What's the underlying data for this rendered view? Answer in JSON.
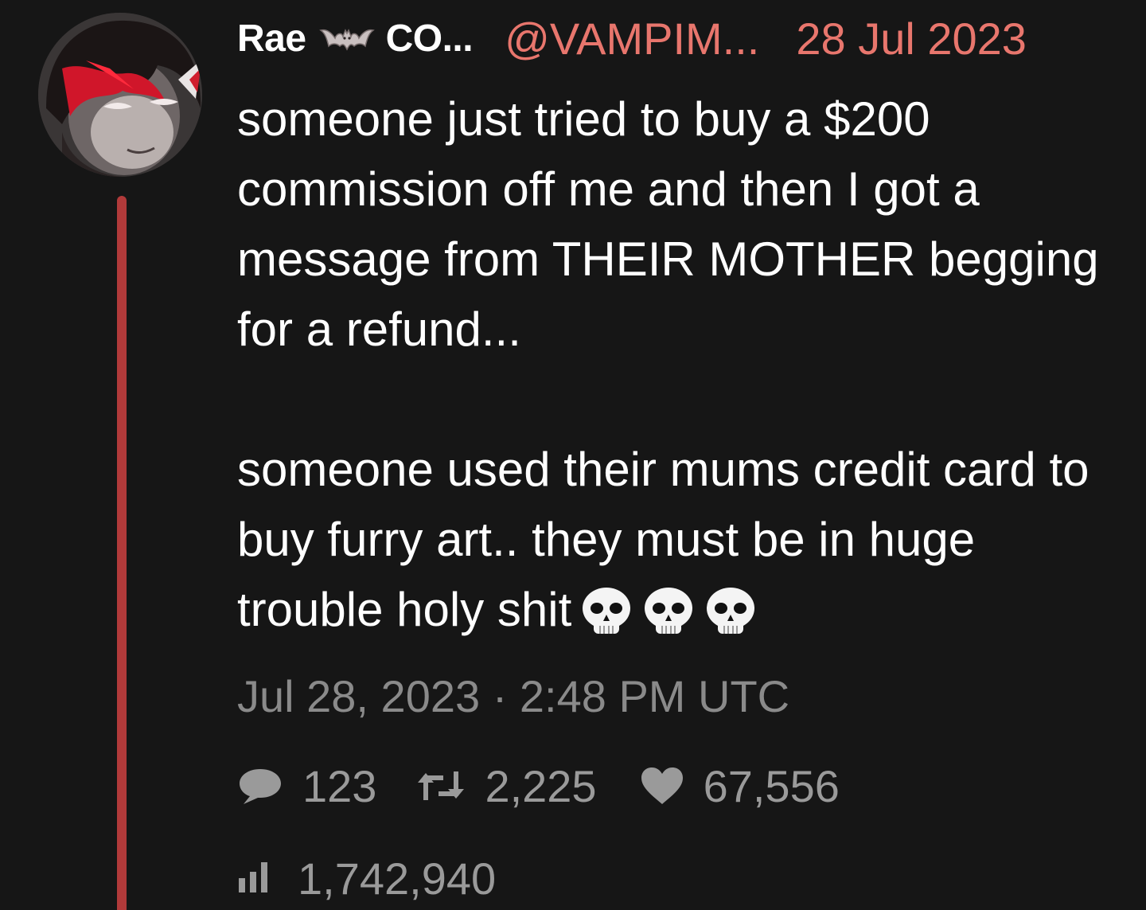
{
  "header": {
    "display_name": "Rae",
    "name_suffix": "CO...",
    "handle": "@VAMPIM...",
    "date": "28 Jul 2023"
  },
  "tweet": {
    "paragraph1": "someone just tried to buy a $200 commission off me and then I got a message from THEIR MOTHER begging for a refund...",
    "paragraph2": "someone used their mums credit card to buy furry art.. they must be in huge trouble holy shit"
  },
  "timestamp": "Jul 28, 2023 · 2:48 PM UTC",
  "stats": {
    "replies": "123",
    "retweets": "2,225",
    "likes": "67,556",
    "views": "1,742,940"
  },
  "icons": {
    "name_emoji": "bat-icon",
    "tweet_emoji": "skull-icon",
    "reply": "speech-bubble-icon",
    "retweet": "retweet-icon",
    "like": "heart-icon",
    "views": "bar-chart-icon"
  },
  "colors": {
    "background": "#161616",
    "text": "#ffffff",
    "accent": "#e8766d",
    "muted": "#8a8a8a",
    "thread_line": "#b13a3a"
  }
}
